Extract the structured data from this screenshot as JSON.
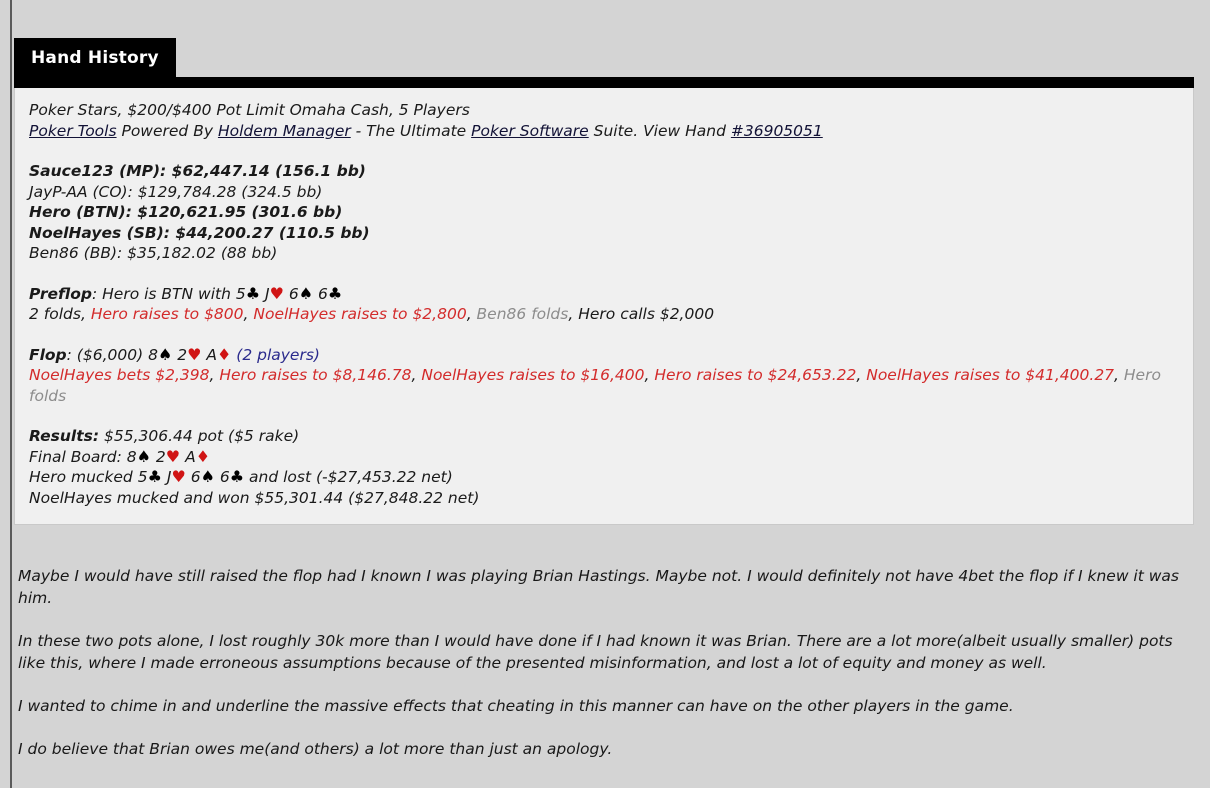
{
  "panel": {
    "tab_label": "Hand History"
  },
  "hand": {
    "header": "Poker Stars, $200/$400 Pot Limit Omaha Cash, 5 Players",
    "tools_line": {
      "link1": "Poker Tools",
      "mid1": " Powered By ",
      "link2": "Holdem Manager",
      "mid2": " - The Ultimate ",
      "link3": "Poker Software",
      "mid3": " Suite. View Hand ",
      "link4": "#36905051"
    },
    "players": [
      {
        "text": "Sauce123 (MP): $62,447.14 (156.1 bb)",
        "bold": false
      },
      {
        "text": "JayP-AA (CO): $129,784.28 (324.5 bb)",
        "bold": false
      },
      {
        "text": "Hero (BTN): $120,621.95 (301.6 bb)",
        "bold": true
      },
      {
        "text": "NoelHayes (SB): $44,200.27 (110.5 bb)",
        "bold": true
      },
      {
        "text": "Ben86 (BB): $35,182.02 (88 bb)",
        "bold": false
      }
    ],
    "preflop": {
      "label": "Preflop",
      "intro": ": Hero is BTN with ",
      "hero_cards": [
        {
          "rank": "5",
          "suit": "♣",
          "color": "black"
        },
        {
          "rank": "J",
          "suit": "♥",
          "color": "red"
        },
        {
          "rank": "6",
          "suit": "♠",
          "color": "black"
        },
        {
          "rank": "6",
          "suit": "♣",
          "color": "black"
        }
      ],
      "actions": [
        {
          "text": "2 folds",
          "color": "black"
        },
        {
          "text": ", ",
          "color": "black"
        },
        {
          "text": "Hero raises to $800",
          "color": "red"
        },
        {
          "text": ", ",
          "color": "black"
        },
        {
          "text": "NoelHayes raises to $2,800",
          "color": "red"
        },
        {
          "text": ", ",
          "color": "black"
        },
        {
          "text": "Ben86 folds",
          "color": "gray"
        },
        {
          "text": ", ",
          "color": "black"
        },
        {
          "text": "Hero calls $2,000",
          "color": "black"
        }
      ]
    },
    "flop": {
      "label": "Flop",
      "pot": ": ($6,000) ",
      "board": [
        {
          "rank": "8",
          "suit": "♠",
          "color": "black"
        },
        {
          "rank": "2",
          "suit": "♥",
          "color": "red"
        },
        {
          "rank": "A",
          "suit": "♦",
          "color": "red"
        }
      ],
      "players_note": "(2 players)",
      "actions": [
        {
          "text": "NoelHayes bets $2,398",
          "color": "red"
        },
        {
          "text": ", ",
          "color": "black"
        },
        {
          "text": "Hero raises to $8,146.78",
          "color": "red"
        },
        {
          "text": ", ",
          "color": "black"
        },
        {
          "text": "NoelHayes raises to $16,400",
          "color": "red"
        },
        {
          "text": ", ",
          "color": "black"
        },
        {
          "text": "Hero raises to $24,653.22",
          "color": "red"
        },
        {
          "text": ", ",
          "color": "black"
        },
        {
          "text": "NoelHayes raises to $41,400.27",
          "color": "red"
        },
        {
          "text": ", ",
          "color": "black"
        },
        {
          "text": "Hero folds",
          "color": "gray"
        }
      ]
    },
    "results": {
      "label": "Results:",
      "pot_text": " $55,306.44 pot ($5 rake)",
      "final_board_label": "Final Board: ",
      "final_board": [
        {
          "rank": "8",
          "suit": "♠",
          "color": "black"
        },
        {
          "rank": "2",
          "suit": "♥",
          "color": "red"
        },
        {
          "rank": "A",
          "suit": "♦",
          "color": "red"
        }
      ],
      "hero_muck_pre": "Hero mucked ",
      "hero_cards": [
        {
          "rank": "5",
          "suit": "♣",
          "color": "black"
        },
        {
          "rank": "J",
          "suit": "♥",
          "color": "red"
        },
        {
          "rank": "6",
          "suit": "♠",
          "color": "black"
        },
        {
          "rank": "6",
          "suit": "♣",
          "color": "black"
        }
      ],
      "hero_muck_post": " and lost (-$27,453.22 net)",
      "villain_line": "NoelHayes mucked and won $55,301.44 ($27,848.22 net)"
    }
  },
  "commentary": {
    "paragraphs": [
      "Maybe I would have still raised the flop had I known I was playing Brian Hastings. Maybe not. I would definitely not have 4bet the flop if I knew it was him.",
      "In these two pots alone, I lost roughly 30k more than I would have done if I had known it was Brian. There are a lot more(albeit usually smaller) pots like this, where I made erroneous assumptions because of the presented misinformation, and lost a lot of equity and money as well.",
      "I wanted to chime in and underline the massive effects that cheating in this manner can have on the other players in the game.",
      "I do believe that Brian owes me(and others) a lot more than just an apology."
    ]
  },
  "colors": {
    "accent_red": "#d32b2b",
    "muted_gray": "#8c8c8c",
    "blue_note": "#2a2a8c",
    "panel_bg": "#f0f0f0",
    "page_bg": "#d4d4d4"
  }
}
